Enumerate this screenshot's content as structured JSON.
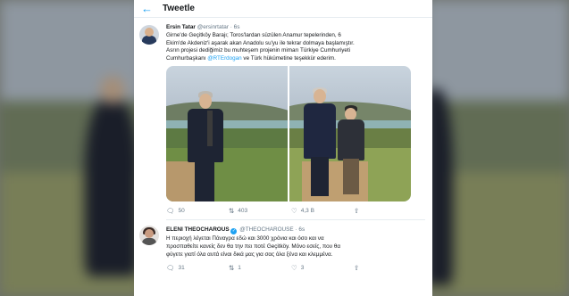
{
  "topbar": {
    "back_icon": "arrow-left-icon",
    "title": "Tweetle"
  },
  "tweets": [
    {
      "name": "Ersin Tatar",
      "handle": "@ersinrtatar",
      "dot": "·",
      "time": "6s",
      "lines": [
        "Girne'de Geçitköy Barajı; Toros'lardan süzülen Anamur tepelerinden, 6",
        "Ekim'de Akdeniz'i aşarak akan Anadolu su'yu ile tekrar dolmaya başlamıştır.",
        "Asrın projesi dediğimiz bu muhteşem projenin mimarı Türkiye Cumhuriyeti"
      ],
      "last_line_prefix": "Cumhurbaşkanı ",
      "mention": "@RTErdogan",
      "last_line_suffix": " ve Türk hükümetine teşekkür ederim.",
      "replies": "50",
      "retweets": "403",
      "likes": "4,3 B"
    },
    {
      "name": "ELENI THEOCHAROUS",
      "handle": "@THEOCHAROUSE",
      "dot": "·",
      "time": "6s",
      "lines": [
        "Η περιοχή λέγεται   Πάναγρα εδώ και 3000 χρόνια και όσο και να",
        "προσπαθείτε κανείς δεν θα την πει ποτέ Geçitköy. Μόνο εσείς, που θα",
        "φύγετε γιατί όλα αυτά είναι δικά μας για σας όλα ξένα και κλεμμένα."
      ],
      "replies": "31",
      "retweets": "1",
      "likes": "3"
    }
  ],
  "icons": {
    "reply": "reply-icon",
    "retweet": "retweet-icon",
    "like": "heart-icon",
    "share": "share-icon",
    "verified": "verified-badge-icon"
  },
  "colors": {
    "accent": "#1da1f2",
    "text": "#14171a",
    "muted": "#657786"
  }
}
